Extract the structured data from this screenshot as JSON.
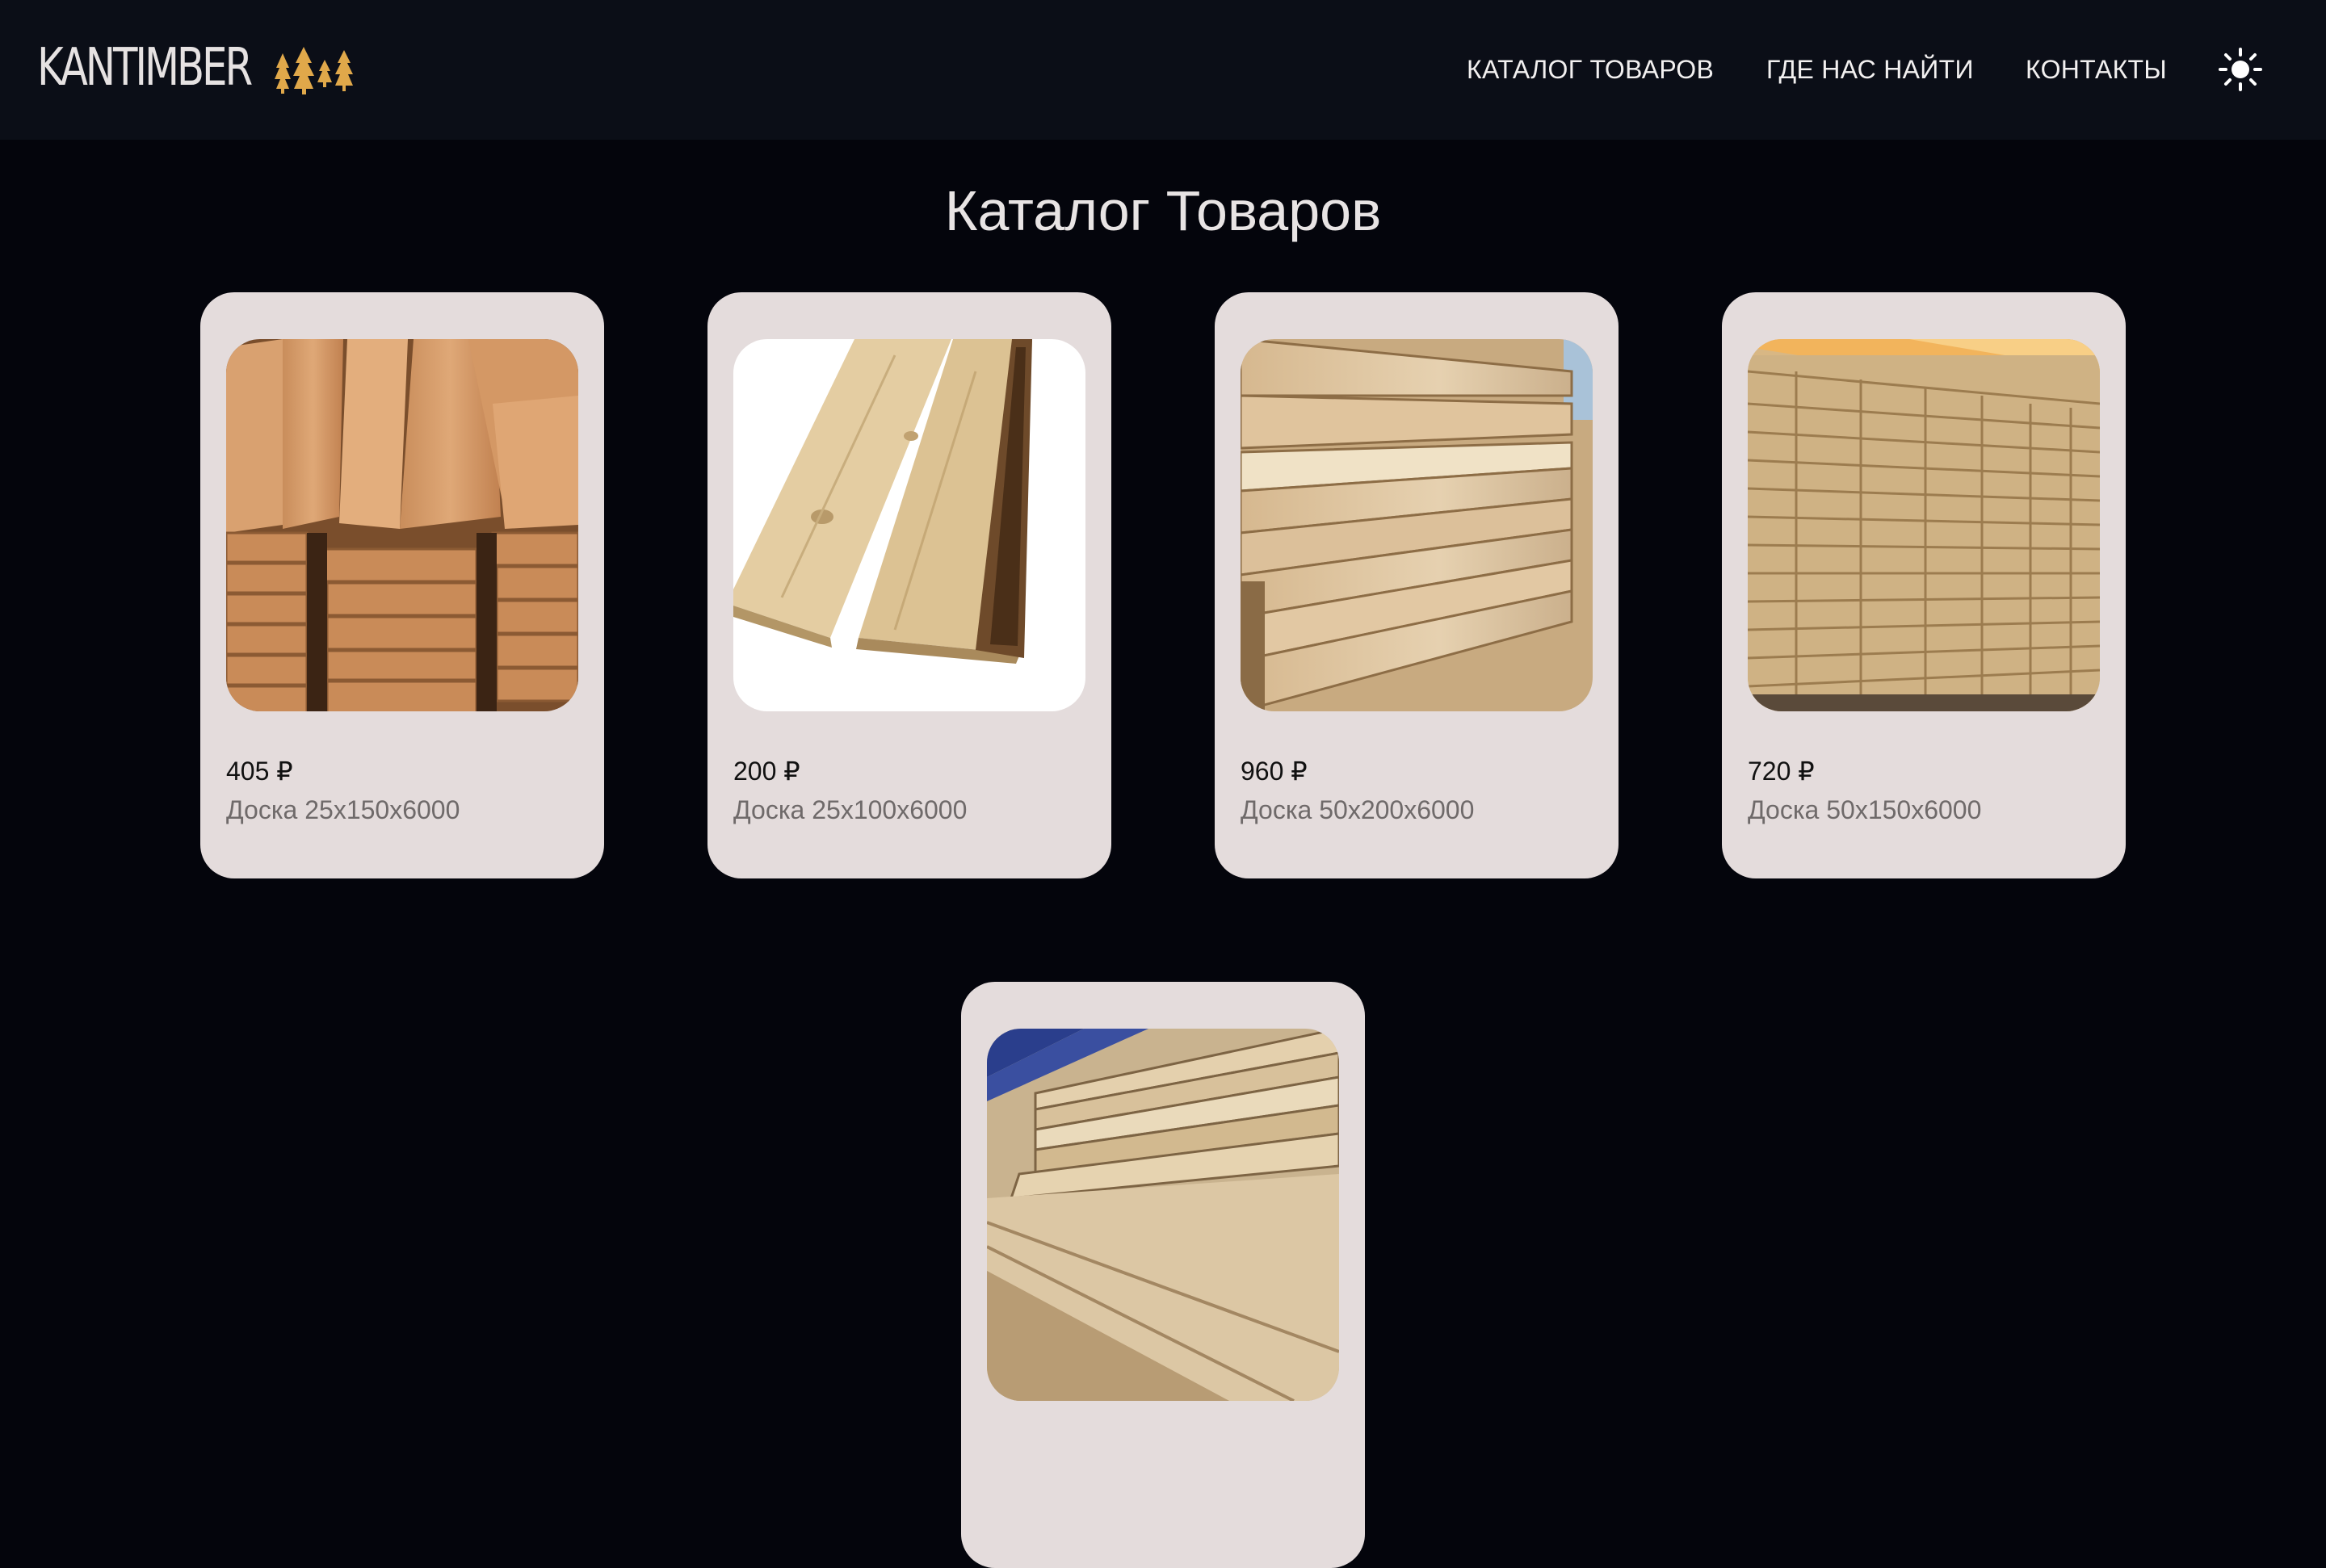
{
  "brand": {
    "name": "KANTIMBER",
    "logo_icon": "pine-trees-icon",
    "accent_color": "#e0a84a"
  },
  "nav": {
    "items": [
      {
        "label": "КАТАЛОГ ТОВАРОВ"
      },
      {
        "label": "ГДЕ НАС НАЙТИ"
      },
      {
        "label": "КОНТАКТЫ"
      }
    ],
    "theme_toggle_icon": "sun-icon"
  },
  "page": {
    "title": "Каталог Товаров",
    "background": "#04050c",
    "header_background": "#0b0e17",
    "card_background": "#e4dcdc"
  },
  "products": [
    {
      "price": "405 ₽",
      "name": "Доска 25x150x6000",
      "image": "stacked-boards-photo"
    },
    {
      "price": "200 ₽",
      "name": "Доска 25x100x6000",
      "image": "unedged-board-photo"
    },
    {
      "price": "960 ₽",
      "name": "Доска 50x200x6000",
      "image": "lumber-stack-side-photo"
    },
    {
      "price": "720 ₽",
      "name": "Доска 50x150x6000",
      "image": "lumber-stack-end-photo"
    },
    {
      "price": "",
      "name": "",
      "image": "long-boards-photo"
    }
  ]
}
